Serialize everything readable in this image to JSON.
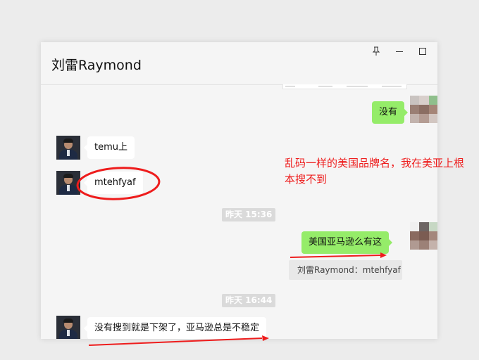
{
  "window": {
    "title": "刘雷Raymond",
    "controls": {
      "pin": "pin-icon",
      "minimize": "minimize-icon",
      "maximize": "maximize-icon"
    }
  },
  "messages": [
    {
      "side": "right",
      "text": "没有"
    },
    {
      "side": "left",
      "text": "temu上"
    },
    {
      "side": "left",
      "text": "mtehfyaf"
    },
    {
      "type": "timestamp",
      "text": "昨天 15:36"
    },
    {
      "side": "right",
      "text": "美国亚马逊么有这"
    },
    {
      "type": "quote",
      "text": "刘雷Raymond：mtehfyaf"
    },
    {
      "type": "timestamp",
      "text": "昨天 16:44"
    },
    {
      "side": "left",
      "text": "没有搜到就是下架了，亚马逊总是不稳定"
    }
  ],
  "annotation": {
    "text": "乱码一样的美国品牌名，我在美亚上根本搜不到",
    "color": "#ee1c1c"
  },
  "colors": {
    "bubble_green": "#95ec69",
    "annotation_red": "#ee1c1c",
    "window_bg": "#f5f5f5"
  }
}
